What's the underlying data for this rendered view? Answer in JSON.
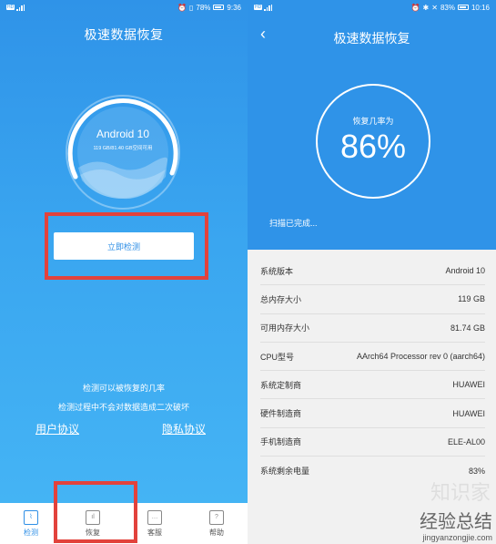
{
  "left": {
    "status": {
      "left": "HD .ill",
      "battery_pct": "78%",
      "time": "9:36"
    },
    "title": "极速数据恢复",
    "gauge": {
      "os": "Android 10",
      "storage": "119 GB/81.40 GB空间可用"
    },
    "detect_button": "立即检测",
    "info_line1": "检测可以被恢复的几率",
    "info_line2": "检测过程中不会对数据造成二次破坏",
    "link_user": "用户协议",
    "link_privacy": "隐私协议",
    "tabs": [
      {
        "label": "检测",
        "icon": "monitor-icon"
      },
      {
        "label": "恢复",
        "icon": "bar-chart-icon"
      },
      {
        "label": "客服",
        "icon": "chat-icon"
      },
      {
        "label": "帮助",
        "icon": "help-icon"
      }
    ],
    "accent": "#2f93e8",
    "highlight": "#e2423c"
  },
  "right": {
    "status": {
      "left": "HD .ill",
      "battery_pct": "83%",
      "time": "10:16"
    },
    "title": "极速数据恢复",
    "recovery_label": "恢复几率为",
    "recovery_pct": "86%",
    "scan_status": "扫描已完成...",
    "rows": [
      {
        "label": "系统版本",
        "value": "Android 10"
      },
      {
        "label": "总内存大小",
        "value": "119 GB"
      },
      {
        "label": "可用内存大小",
        "value": "81.74 GB"
      },
      {
        "label": "CPU型号",
        "value": "AArch64 Processor rev 0 (aarch64)"
      },
      {
        "label": "系统定制商",
        "value": "HUAWEI"
      },
      {
        "label": "硬件制造商",
        "value": "HUAWEI"
      },
      {
        "label": "手机制造商",
        "value": "ELE-AL00"
      },
      {
        "label": "系统剩余电量",
        "value": "83%"
      }
    ],
    "watermark_main": "经验总结",
    "watermark_url": "jingyanzongjie.com",
    "watermark_bg": "知识家"
  }
}
